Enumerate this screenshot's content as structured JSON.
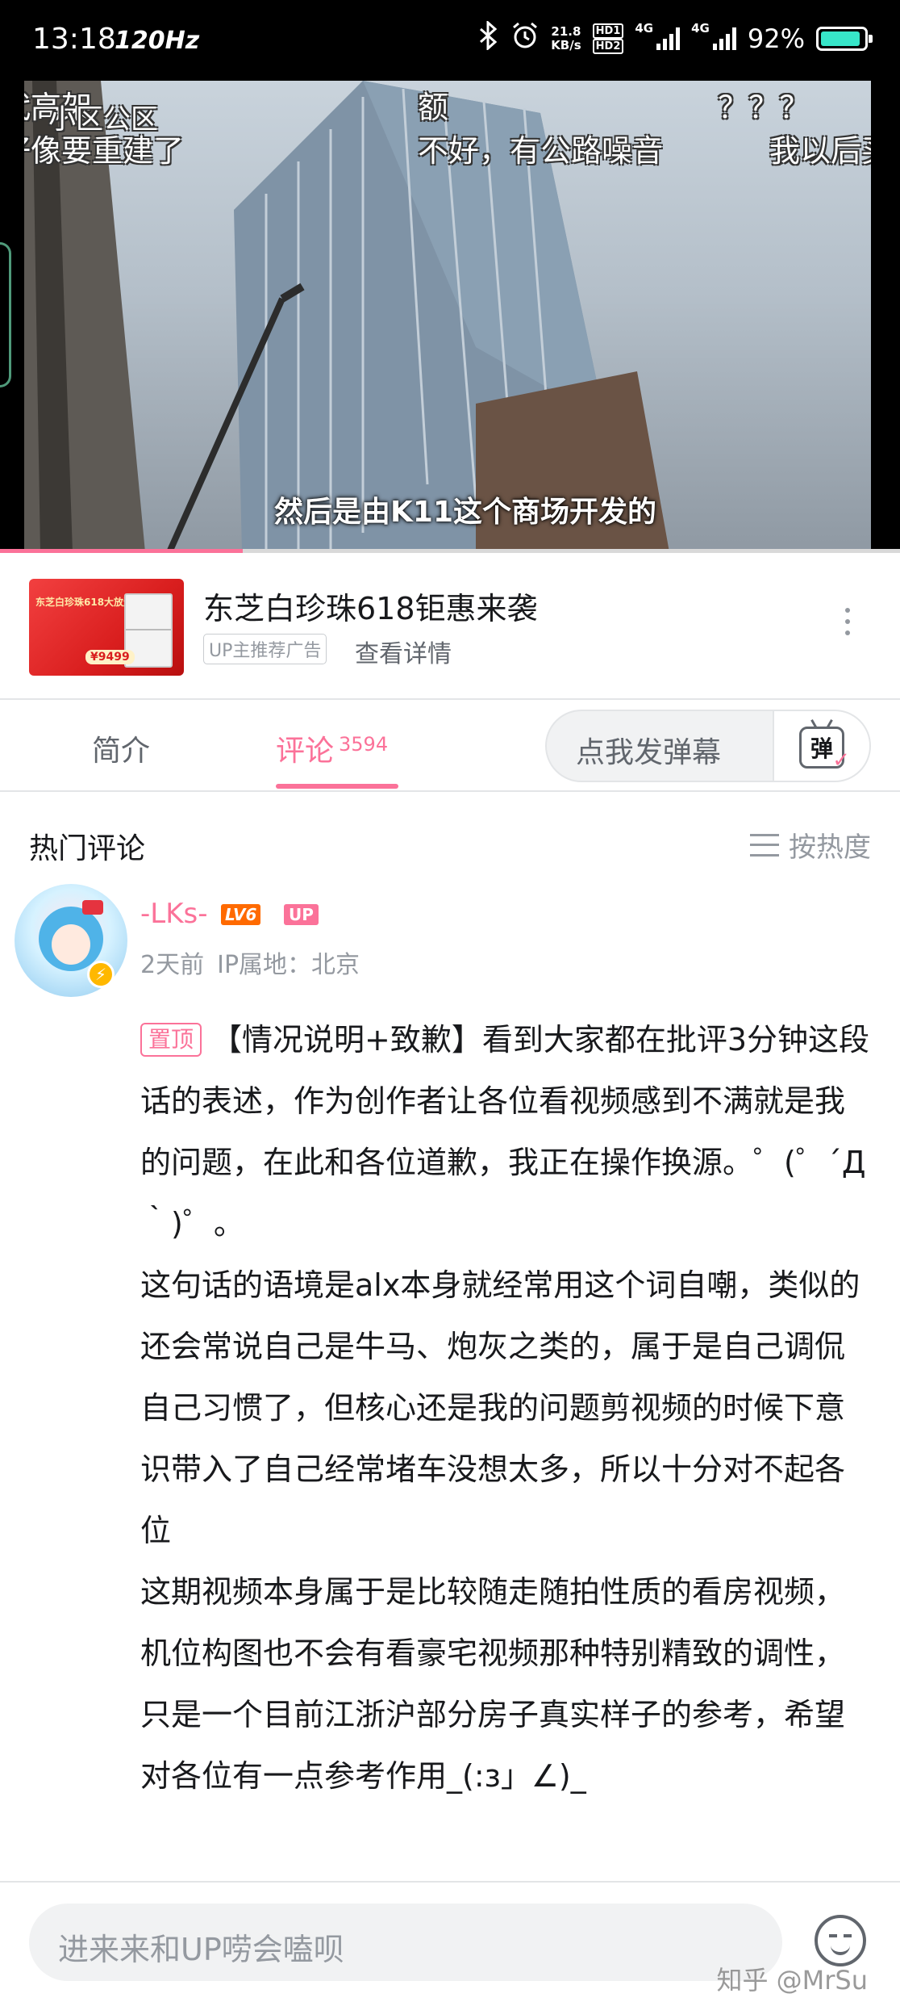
{
  "status_bar": {
    "time": "13:18",
    "refresh_rate": "120Hz",
    "net_speed": "21.8",
    "net_speed_unit": "KB/s",
    "hd1": "HD1",
    "hd2": "HD2",
    "network_1": "4G",
    "network_2": "4G",
    "battery": "92%"
  },
  "video": {
    "danmaku": [
      "代高架",
      "小区公区",
      "好像要重建了",
      "额",
      "不好，有公路噪音",
      "？？？",
      "我以后买，"
    ],
    "subtitle": "然后是由K11这个商场开发的",
    "progress": 0.27
  },
  "ad": {
    "title": "东芝白珍珠618钜惠来袭",
    "tag": "UP主推荐广告",
    "detail_link": "查看详情",
    "thumb_text": "东芝白珍珠618大放送",
    "thumb_price": "¥9499"
  },
  "tabs": {
    "intro": "简介",
    "comments": "评论",
    "comment_count": "3594",
    "danmaku_placeholder": "点我发弹幕",
    "danmaku_button_glyph": "弹"
  },
  "comments_section": {
    "title": "热门评论",
    "sort_label": "按热度"
  },
  "comment": {
    "username": "-LKs-",
    "level": "LV6",
    "up_badge": "UP",
    "time": "2天前",
    "ip": "IP属地：北京",
    "pinned_label": "置顶",
    "paragraphs": [
      "【情况说明+致歉】看到大家都在批评3分钟这段话的表述，作为创作者让各位看视频感到不满就是我的问题，在此和各位道歉，我正在操作换源。゜(゜´Д｀)゜。",
      "这句话的语境是alx本身就经常用这个词自嘲，类似的还会常说自己是牛马、炮灰之类的，属于是自己调侃自己习惯了，但核心还是我的问题剪视频的时候下意识带入了自己经常堵车没想太多，所以十分对不起各位",
      "这期视频本身属于是比较随走随拍性质的看房视频，机位构图也不会有看豪宅视频那种特别精致的调性，只是一个目前江浙沪部分房子真实样子的参考，希望对各位有一点参考作用_(:з」∠)_"
    ]
  },
  "bottom": {
    "reply_placeholder": "进来来和UP唠会嗑呗",
    "watermark": "知乎 @MrSu"
  },
  "colors": {
    "accent": "#fb7299",
    "level_badge": "#ff6a00",
    "battery_fill": "#37e6c9"
  }
}
